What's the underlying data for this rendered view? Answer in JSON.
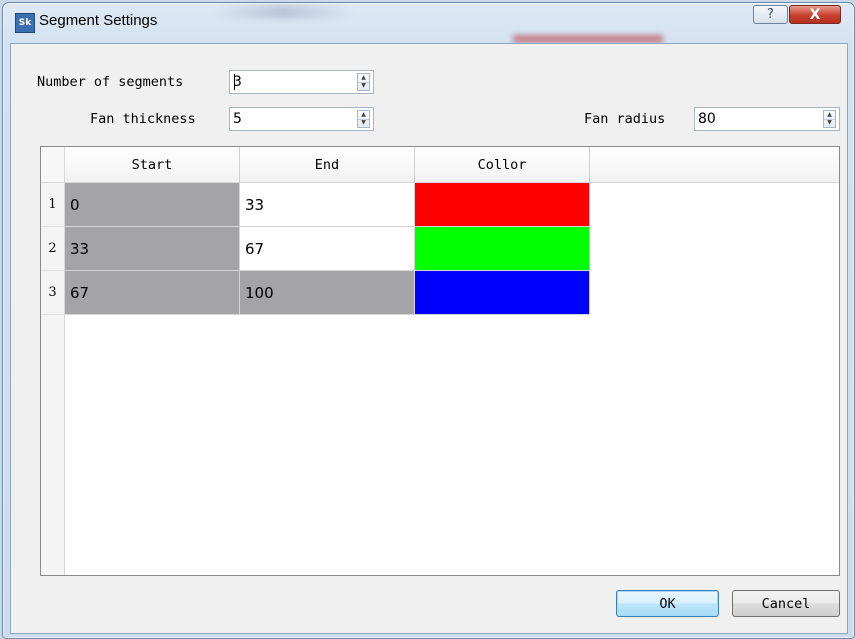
{
  "window": {
    "title": "Segment Settings",
    "icon_text": "Sk",
    "help_glyph": "?",
    "close_glyph": "X"
  },
  "fields": {
    "segments": {
      "label": "Number of segments",
      "value": "3"
    },
    "thickness": {
      "label": "Fan thickness",
      "value": "5"
    },
    "radius": {
      "label": "Fan radius",
      "value": "80"
    }
  },
  "table": {
    "columns": [
      "Start",
      "End",
      "Collor"
    ],
    "rows": [
      {
        "num": "1",
        "start": "0",
        "end": "33",
        "color": "#ff0000"
      },
      {
        "num": "2",
        "start": "33",
        "end": "67",
        "color": "#00ff00"
      },
      {
        "num": "3",
        "start": "67",
        "end": "100",
        "color": "#0000ff"
      }
    ]
  },
  "buttons": {
    "ok": "OK",
    "cancel": "Cancel"
  }
}
